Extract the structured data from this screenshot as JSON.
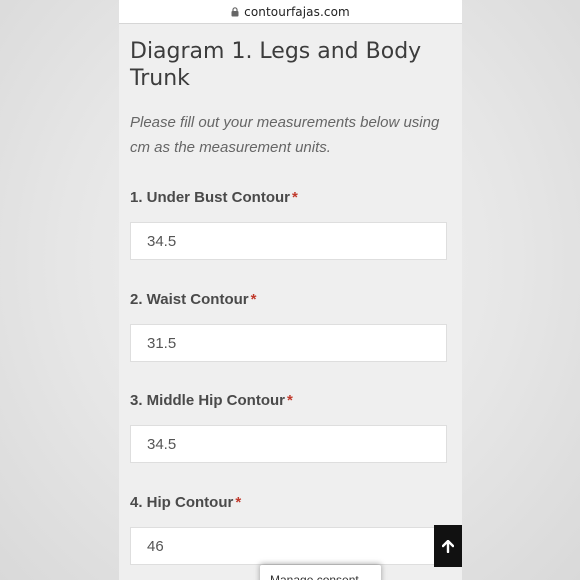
{
  "browser": {
    "url": "contourfajas.com",
    "lock_icon": "lock-icon"
  },
  "form": {
    "title": "Diagram 1. Legs and Body Trunk",
    "intro": "Please fill out your measurements below using cm as the measurement units.",
    "required_marker": "*",
    "fields": [
      {
        "label": "1. Under Bust Contour",
        "value": "34.5"
      },
      {
        "label": "2. Waist Contour",
        "value": "31.5"
      },
      {
        "label": "3. Middle Hip Contour",
        "value": "34.5"
      },
      {
        "label": "4. Hip Contour",
        "value": "46"
      }
    ]
  },
  "scroll_top": {
    "icon": "arrow-up-icon"
  },
  "consent": {
    "label": "Manage consent"
  },
  "colors": {
    "required": "#c0392b",
    "scroll_button": "#111111"
  }
}
